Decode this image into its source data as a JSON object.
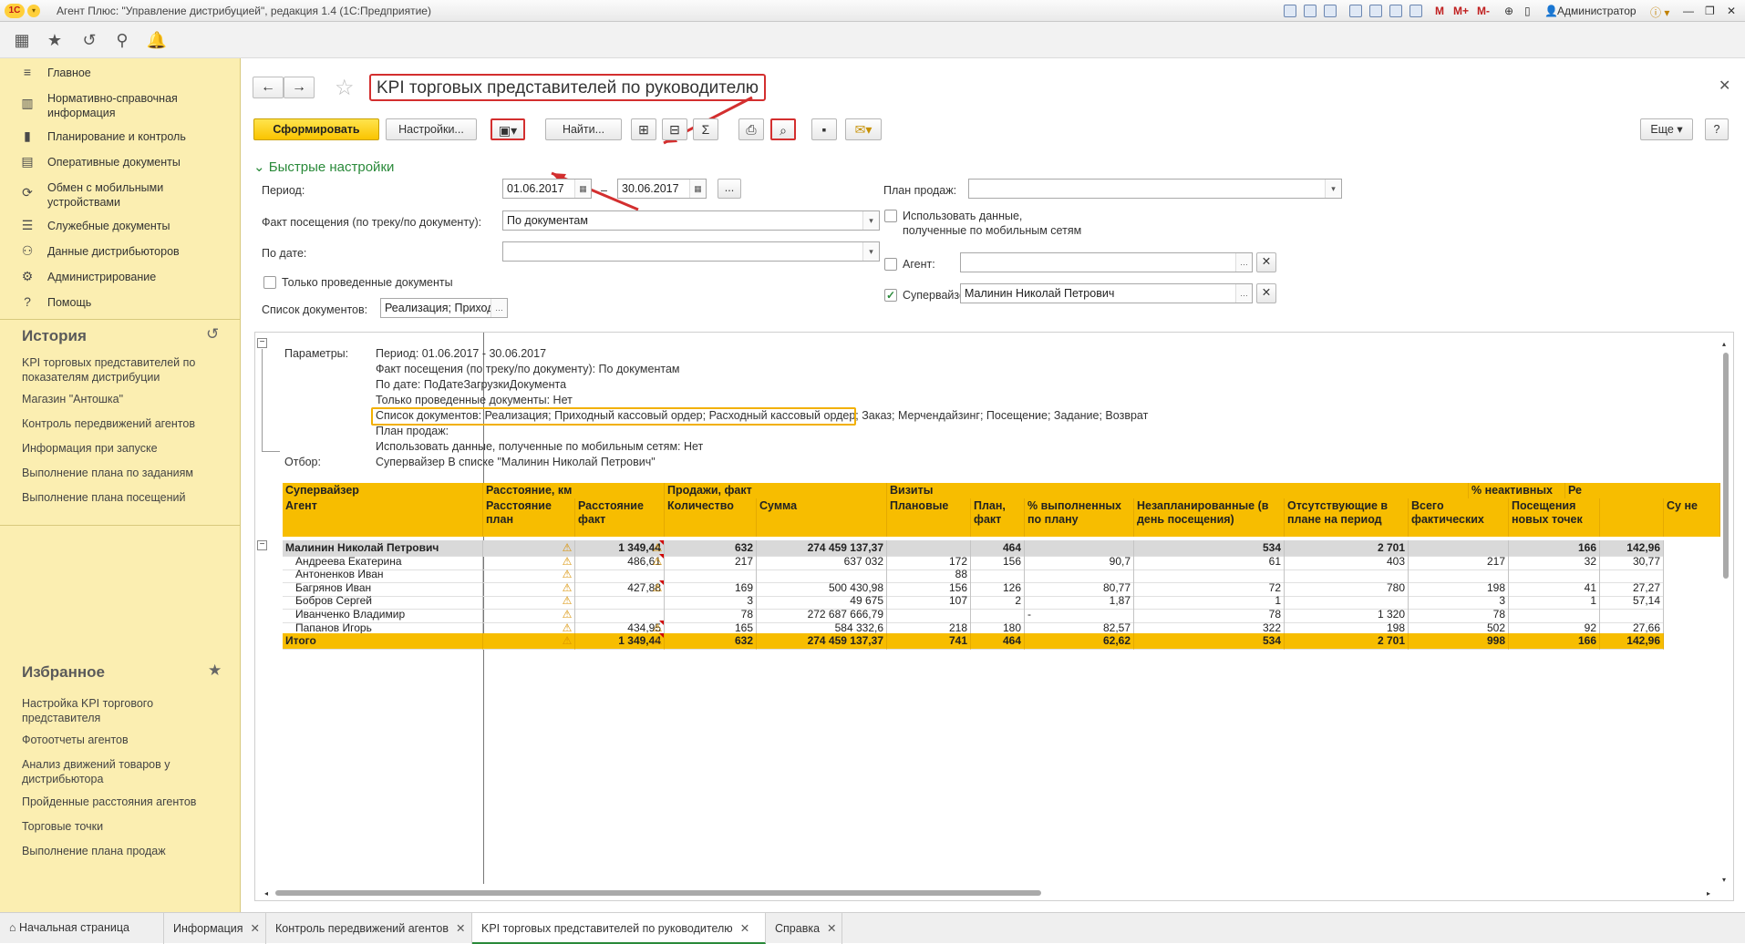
{
  "window": {
    "title": "Агент Плюс: \"Управление дистрибуцией\", редакция 1.4  (1С:Предприятие)",
    "logo": "1C",
    "user": "Администратор",
    "toolbar_icons": [
      "save-icon",
      "print-icon",
      "preview-icon",
      "copy-icon",
      "compare-icon",
      "calendar-icon",
      "calculator-icon",
      "memo-m-icon",
      "memo-mplus-icon",
      "memo-mminus-icon",
      "zoom-icon",
      "panel-icon",
      "info-icon",
      "minimize-icon",
      "restore-icon",
      "close-icon"
    ]
  },
  "sidebar": {
    "items": [
      {
        "label": "Главное",
        "icon": "menu-icon"
      },
      {
        "label": "Нормативно-справочная информация",
        "icon": "catalog-icon"
      },
      {
        "label": "Планирование и контроль",
        "icon": "chart-icon"
      },
      {
        "label": "Оперативные документы",
        "icon": "document-icon"
      },
      {
        "label": "Обмен с мобильными устройствами",
        "icon": "sync-icon"
      },
      {
        "label": "Служебные документы",
        "icon": "list-icon"
      },
      {
        "label": "Данные дистрибьюторов",
        "icon": "people-icon"
      },
      {
        "label": "Администрирование",
        "icon": "gear-icon"
      },
      {
        "label": "Помощь",
        "icon": "help-icon"
      }
    ],
    "history_title": "История",
    "history": [
      "KPI торговых представителей по показателям дистрибуции",
      "Магазин \"Антошка\"",
      "Контроль передвижений агентов",
      "Информация при запуске",
      "Выполнение плана по заданиям",
      "Выполнение плана посещений"
    ],
    "favorites_title": "Избранное",
    "favorites": [
      "Настройка KPI торгового представителя",
      "Фотоотчеты агентов",
      "Анализ движений товаров у дистрибьютора",
      "Пройденные расстояния агентов",
      "Торговые точки",
      "Выполнение плана продаж"
    ]
  },
  "form": {
    "title": "KPI торговых представителей по руководителю",
    "buttons": {
      "generate": "Сформировать",
      "settings": "Настройки...",
      "find": "Найти...",
      "more": "Еще",
      "help": "?",
      "sum": "Σ"
    },
    "quick_settings": "Быстрые настройки",
    "period_label": "Период:",
    "period_from": "01.06.2017",
    "period_to": "30.06.2017",
    "dash": "–",
    "dots": "...",
    "visit_fact_label": "Факт посещения (по треку/по документу):",
    "visit_fact_value": "По документам",
    "by_date_label": "По дате:",
    "by_date_value": "",
    "only_posted_label": "Только проведенные документы",
    "doc_list_label": "Список документов:",
    "doc_list_value": "Реализация; Приходн",
    "plan_label": "План продаж:",
    "plan_value": "",
    "mobile_label_1": "Использовать данные,",
    "mobile_label_2": "полученные по мобильным сетям",
    "agent_label": "Агент:",
    "agent_value": "",
    "supervisor_label": "Супервайзер:",
    "supervisor_value": "Малинин Николай Петрович"
  },
  "report": {
    "params_label": "Параметры:",
    "params": [
      "Период: 01.06.2017 - 30.06.2017",
      "Факт посещения (по треку/по документу): По документам",
      "По дате: ПоДатеЗагрузкиДокумента",
      "Только проведенные документы: Нет",
      "Список документов: Реализация; Приходный кассовый ордер; Расходный кассовый ордер; Заказ; Мерчендайзинг; Посещение; Задание; Возврат",
      "План продаж:",
      "Использовать данные, полученные по мобильным сетям: Нет"
    ],
    "filter_label": "Отбор:",
    "filter": "Супервайзер В списке \"Малинин Николай Петрович\"",
    "header_groups": [
      "Супервайзер",
      "Расстояние, км",
      "Продажи, факт",
      "Визиты",
      "% неактивных",
      "Ре"
    ],
    "headers": [
      "Агент",
      "Расстояние план",
      "Расстояние факт",
      "Количество",
      "Сумма",
      "Плановые",
      "План, факт",
      "% выполненных по плану",
      "Незапланированные (в день посещения)",
      "Отсутствующие в плане на период",
      "Всего фактических",
      "Посещения новых точек",
      "",
      "Су не"
    ],
    "group_row": [
      "Малинин Николай Петрович",
      "",
      "1 349,44",
      "632",
      "274 459 137,37",
      "",
      "464",
      "",
      "534",
      "2 701",
      "",
      "166",
      "142,96"
    ],
    "rows": [
      [
        "Андреева Екатерина",
        "",
        "486,61",
        "217",
        "637 032",
        "172",
        "156",
        "90,7",
        "61",
        "403",
        "217",
        "32",
        "30,77"
      ],
      [
        "Антоненков Иван",
        "",
        "",
        "",
        "",
        "88",
        "",
        "",
        "",
        "",
        "",
        "",
        ""
      ],
      [
        "Багрянов Иван",
        "",
        "427,88",
        "169",
        "500 430,98",
        "156",
        "126",
        "80,77",
        "72",
        "780",
        "198",
        "41",
        "27,27"
      ],
      [
        "Бобров Сергей",
        "",
        "",
        "3",
        "49 675",
        "107",
        "2",
        "1,87",
        "1",
        "",
        "3",
        "1",
        "57,14"
      ],
      [
        "Иванченко Владимир",
        "",
        "",
        "78",
        "272 687 666,79",
        "",
        "",
        "-",
        "78",
        "1 320",
        "78",
        "",
        ""
      ],
      [
        "Папанов Игорь",
        "",
        "434,95",
        "165",
        "584 332,6",
        "218",
        "180",
        "82,57",
        "322",
        "198",
        "502",
        "92",
        "27,66"
      ]
    ],
    "total_row": [
      "Итого",
      "",
      "1 349,44",
      "632",
      "274 459 137,37",
      "741",
      "464",
      "62,62",
      "534",
      "2 701",
      "998",
      "166",
      "142,96"
    ]
  },
  "tabs": [
    {
      "label": "Начальная страница",
      "closable": false,
      "active": false
    },
    {
      "label": "Информация",
      "closable": true,
      "active": false
    },
    {
      "label": "Контроль передвижений агентов",
      "closable": true,
      "active": false
    },
    {
      "label": "KPI торговых представителей по руководителю",
      "closable": true,
      "active": true
    },
    {
      "label": "Справка",
      "closable": true,
      "active": false
    }
  ],
  "colors": {
    "accent": "#f7bd00",
    "sidebar": "#fbeeb1",
    "callout": "#d32f2f",
    "green": "#2a8a3a"
  }
}
